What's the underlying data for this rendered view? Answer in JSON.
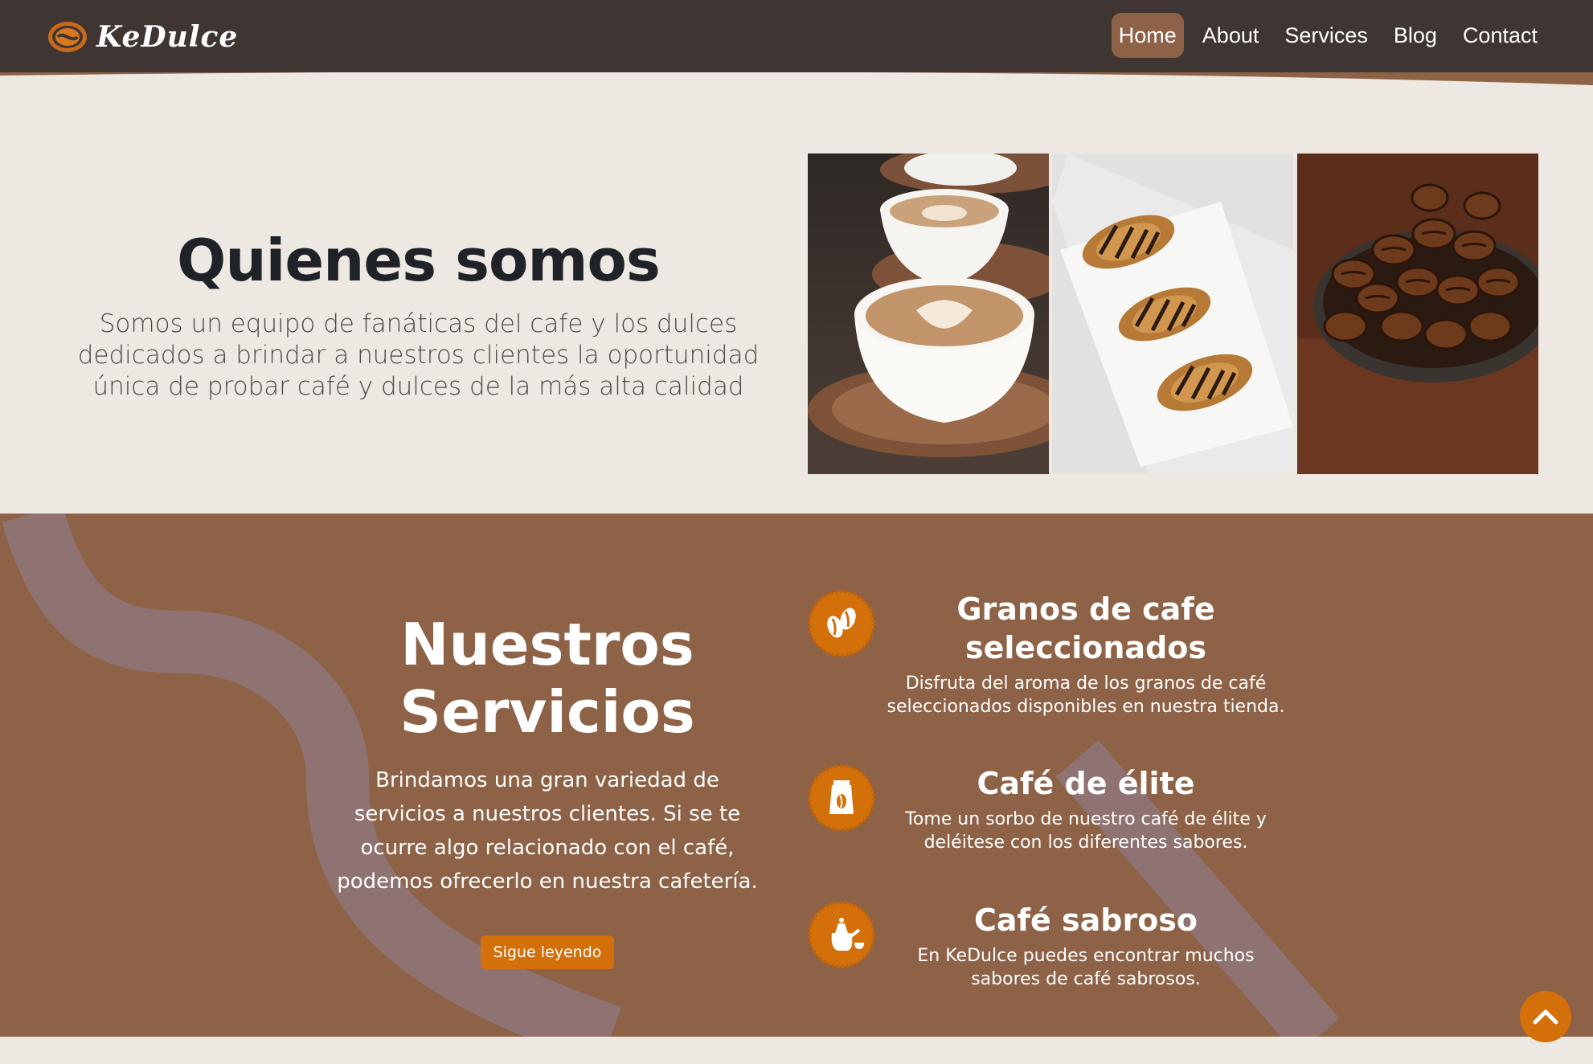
{
  "brand": {
    "name": "KeDulce",
    "logo_icon": "coffee-bean-logo-icon"
  },
  "nav": {
    "items": [
      {
        "label": "Home",
        "active": true
      },
      {
        "label": "About"
      },
      {
        "label": "Services"
      },
      {
        "label": "Blog"
      },
      {
        "label": "Contact"
      }
    ]
  },
  "about": {
    "title": "Quienes somos",
    "body": "Somos un equipo de fanáticas del cafe y los dulces dedicados a brindar a nuestros clientes la oportunidad única de probar café y dulces de la más alta calidad",
    "photos": [
      "latte-art-cups-photo",
      "chocolate-croissants-photo",
      "coffee-beans-spoon-photo"
    ]
  },
  "services": {
    "title": "Nuestros Servicios",
    "body": "Brindamos una gran variedad de servicios a nuestros clientes. Si se te ocurre algo relacionado con el café, podemos ofrecerlo en nuestra cafetería.",
    "button_label": "Sigue leyendo",
    "features": [
      {
        "icon": "coffee-beans-icon",
        "title": "Granos de cafe seleccionados",
        "desc": "Disfruta del aroma de los granos de café seleccionados disponibles en nuestra tienda."
      },
      {
        "icon": "coffee-bag-icon",
        "title": "Café de élite",
        "desc": "Tome un sorbo de nuestro café de élite y deléitese con los diferentes sabores."
      },
      {
        "icon": "coffee-pot-icon",
        "title": "Café sabroso",
        "desc": "En KeDulce puedes encontrar muchos sabores de café sabrosos."
      }
    ]
  },
  "back_to_top": {
    "icon": "chevron-up-icon"
  },
  "colors": {
    "navbar": "#3f3633",
    "accent_brown": "#8d6246",
    "orange": "#d3700a",
    "background": "#ede9e2"
  }
}
